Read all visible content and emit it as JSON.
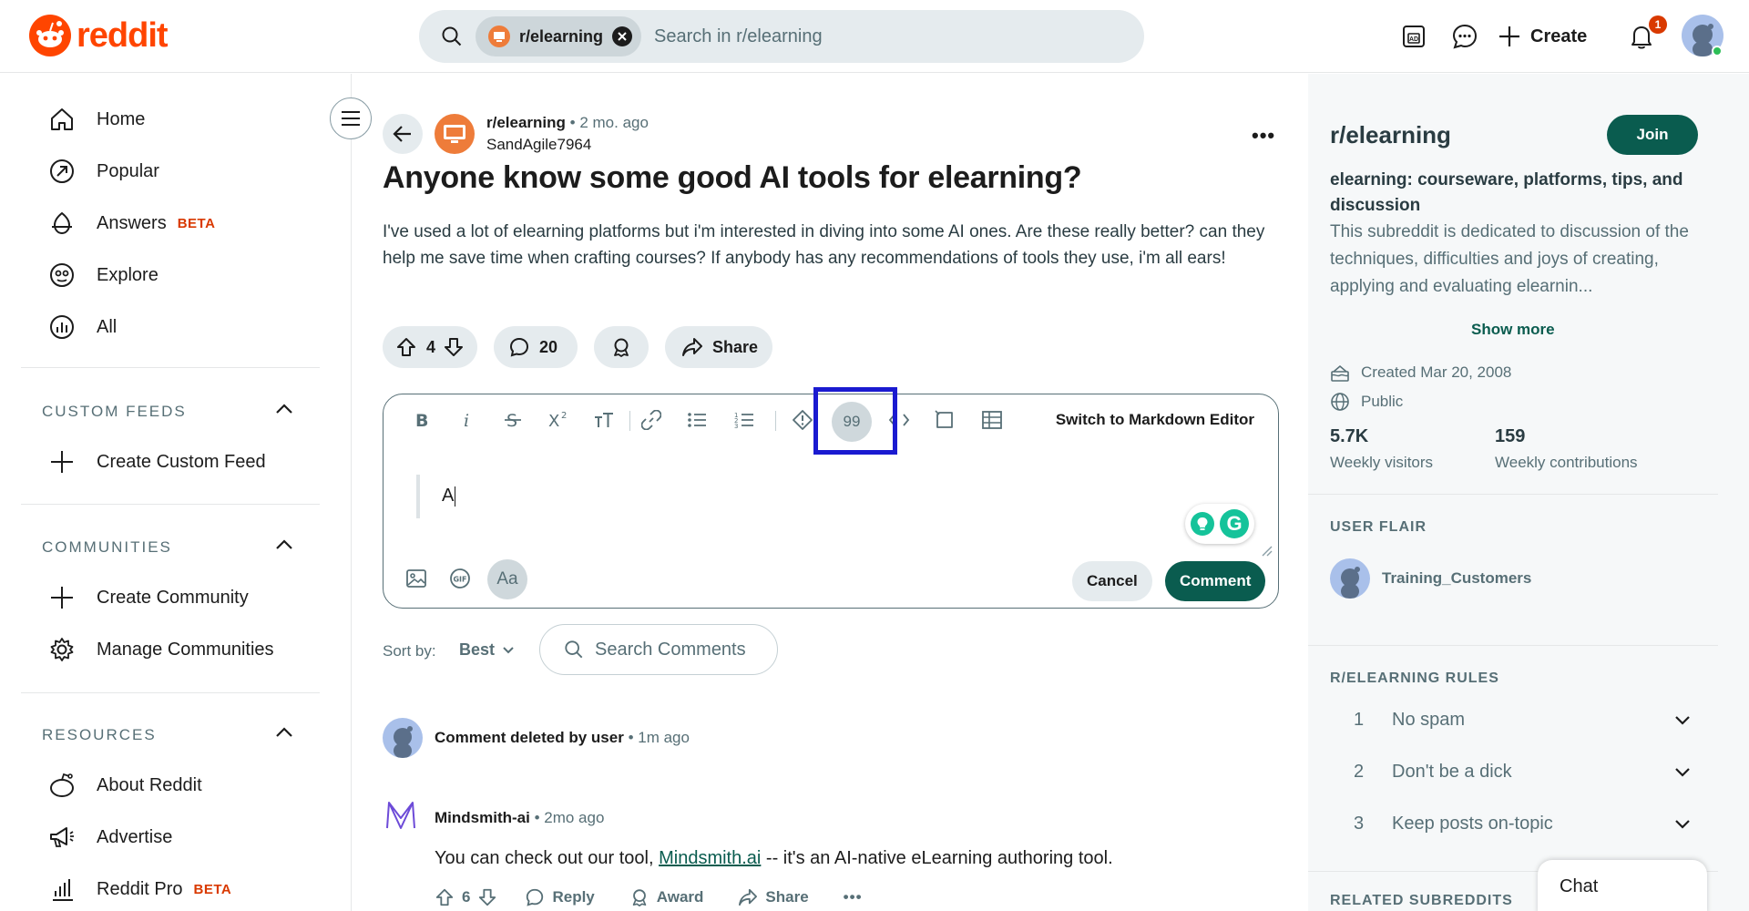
{
  "header": {
    "logo_text": "reddit",
    "search": {
      "chip": "r/elearning",
      "placeholder": "Search in r/elearning"
    },
    "create_label": "Create",
    "notification_count": "1"
  },
  "left_nav": {
    "items": [
      {
        "label": "Home",
        "icon": "home-icon"
      },
      {
        "label": "Popular",
        "icon": "popular-icon"
      },
      {
        "label": "Answers",
        "icon": "answers-icon",
        "badge": "BETA"
      },
      {
        "label": "Explore",
        "icon": "explore-icon"
      },
      {
        "label": "All",
        "icon": "all-icon"
      }
    ],
    "custom_feeds": {
      "title": "CUSTOM FEEDS",
      "items": [
        {
          "label": "Create Custom Feed"
        }
      ]
    },
    "communities": {
      "title": "COMMUNITIES",
      "items": [
        {
          "label": "Create Community"
        },
        {
          "label": "Manage Communities"
        }
      ]
    },
    "resources": {
      "title": "RESOURCES",
      "items": [
        {
          "label": "About Reddit"
        },
        {
          "label": "Advertise"
        },
        {
          "label": "Reddit Pro",
          "badge": "BETA"
        }
      ]
    }
  },
  "post": {
    "subreddit": "r/elearning",
    "time": "2 mo. ago",
    "author": "SandAgile7964",
    "title": "Anyone know some good AI tools for elearning?",
    "body": "I've used a lot of elearning platforms but i'm interested in diving into some AI ones. Are these really better? can they help me save time when crafting courses? If anybody has any recommendations of tools they use, i'm all ears!",
    "votes": "4",
    "comments": "20",
    "share_label": "Share"
  },
  "editor": {
    "switch_label": "Switch to Markdown Editor",
    "quote_glyph": "99",
    "typed_text": "A",
    "aa_label": "Aa",
    "cancel_label": "Cancel",
    "comment_label": "Comment"
  },
  "sort": {
    "label": "Sort by:",
    "value": "Best",
    "search_placeholder": "Search Comments"
  },
  "comments": [
    {
      "author": "Comment deleted by user",
      "time": "1m ago"
    },
    {
      "author": "Mindsmith-ai",
      "time": "2mo ago",
      "text_before": "You can check out our tool, ",
      "link": "Mindsmith.ai",
      "text_after": " -- it's an AI-native eLearning authoring tool.",
      "votes": "6",
      "reply": "Reply",
      "award": "Award",
      "share": "Share"
    }
  ],
  "sidebar": {
    "title": "r/elearning",
    "join_label": "Join",
    "heading": "elearning: courseware, platforms, tips, and discussion",
    "description": "This subreddit is dedicated to discussion of the techniques, difficulties and joys of creating, applying and evaluating elearnin...",
    "show_more": "Show more",
    "created": "Created Mar 20, 2008",
    "visibility": "Public",
    "stats": [
      {
        "value": "5.7K",
        "label": "Weekly visitors"
      },
      {
        "value": "159",
        "label": "Weekly contributions"
      }
    ],
    "user_flair_title": "USER FLAIR",
    "flair_name": "Training_Customers",
    "rules_title": "R/ELEARNING RULES",
    "rules": [
      {
        "num": "1",
        "text": "No spam"
      },
      {
        "num": "2",
        "text": "Don't be a dick"
      },
      {
        "num": "3",
        "text": "Keep posts on-topic"
      }
    ],
    "related_title": "RELATED SUBREDDITS",
    "chat_label": "Chat"
  },
  "colors": {
    "brand": "#ff4500",
    "accent": "#0a5c4f",
    "highlight": "#1a1ad0"
  }
}
